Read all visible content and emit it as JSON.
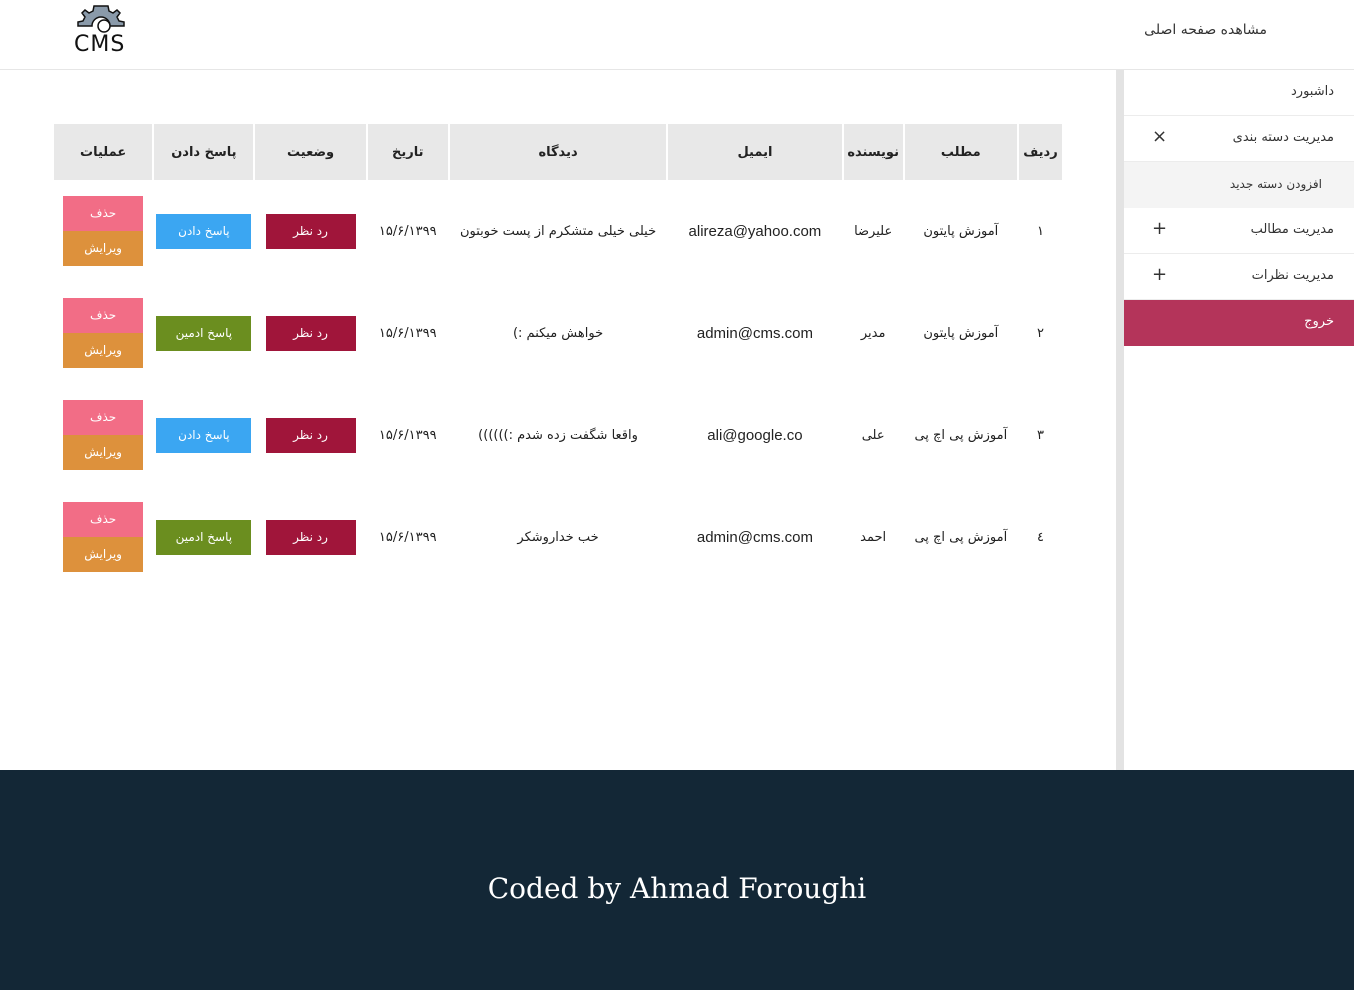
{
  "header": {
    "logo_text": "CMS",
    "home_link": "مشاهده صفحه اصلی"
  },
  "sidebar": {
    "items": [
      {
        "label": "داشبورد"
      },
      {
        "label": "مدیریت دسته بندی",
        "sign": "×"
      },
      {
        "label": "افزودن دسته جدید"
      },
      {
        "label": "مدیریت مطالب",
        "sign": "+"
      },
      {
        "label": "مدیریت نظرات",
        "sign": "+"
      }
    ],
    "logout": "خروج"
  },
  "table": {
    "headers": [
      "ردیف",
      "مطلب",
      "نویسنده",
      "ایمیل",
      "دیدگاه",
      "تاریخ",
      "وضعیت",
      "پاسخ دادن",
      "عملیات"
    ],
    "rows": [
      {
        "num": "١",
        "post": "آموزش پایتون",
        "author": "علیرضا",
        "email": "alireza@yahoo.com",
        "comment": "خیلی خیلی متشکرم از پست خوبتون",
        "date": "١٣٩٩/۶/١۵",
        "status": "رد نظر",
        "reply": "پاسخ دادن",
        "reply_type": "reply",
        "delete": "حذف",
        "edit": "ویرایش"
      },
      {
        "num": "٢",
        "post": "آموزش پایتون",
        "author": "مدیر",
        "email": "admin@cms.com",
        "comment": "خواهش میکنم :)",
        "date": "١٣٩٩/۶/١۵",
        "status": "رد نظر",
        "reply": "پاسخ ادمین",
        "reply_type": "admin",
        "delete": "حذف",
        "edit": "ویرایش"
      },
      {
        "num": "٣",
        "post": "آموزش پی اچ پی",
        "author": "علی",
        "email": "ali@google.co",
        "comment": "واقعا شگفت زده شدم :))))))",
        "date": "١٣٩٩/۶/١۵",
        "status": "رد نظر",
        "reply": "پاسخ دادن",
        "reply_type": "reply",
        "delete": "حذف",
        "edit": "ویرایش"
      },
      {
        "num": "٤",
        "post": "آموزش پی اچ پی",
        "author": "احمد",
        "email": "admin@cms.com",
        "comment": "خب خداروشکر",
        "date": "١٣٩٩/۶/١۵",
        "status": "رد نظر",
        "reply": "پاسخ ادمین",
        "reply_type": "admin",
        "delete": "حذف",
        "edit": "ویرایش"
      }
    ]
  },
  "footer": {
    "text": "Coded by Ahmad Foroughi"
  },
  "colors": {
    "footer_bg": "#132736",
    "logout_bg": "#b4345a",
    "reject": "#a0153a",
    "reply": "#3ba6f2",
    "admin_reply": "#6b8e1f",
    "delete": "#f26d86",
    "edit": "#dd913c"
  }
}
